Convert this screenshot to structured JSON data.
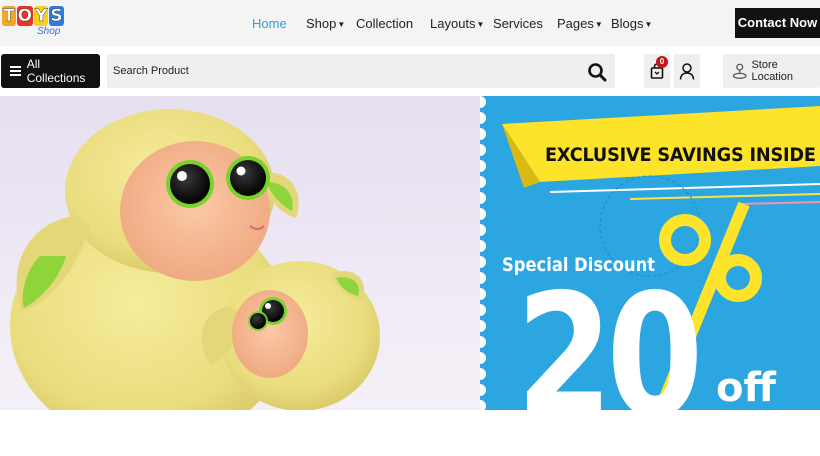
{
  "brand": {
    "logo_letters": [
      "T",
      "O",
      "Y",
      "S"
    ],
    "logo_colors": [
      "#f5a623",
      "#e8332b",
      "#f7d21c",
      "#2f7be0"
    ],
    "logo_sub": "Shop"
  },
  "nav": {
    "items": [
      {
        "label": "Home",
        "active": true,
        "dropdown": false
      },
      {
        "label": "Shop",
        "active": false,
        "dropdown": true
      },
      {
        "label": "Collection",
        "active": false,
        "dropdown": false
      },
      {
        "label": "Layouts",
        "active": false,
        "dropdown": true
      },
      {
        "label": "Services",
        "active": false,
        "dropdown": false
      },
      {
        "label": "Pages",
        "active": false,
        "dropdown": true
      },
      {
        "label": "Blogs",
        "active": false,
        "dropdown": true
      }
    ],
    "contact_label": "Contact Now"
  },
  "toolbar": {
    "collections_label": "All Collections",
    "search_placeholder": "Search Product",
    "cart_count": "0",
    "store_label": "Store Location"
  },
  "hero": {
    "banner_text": "EXCLUSIVE SAVINGS INSIDE",
    "special_text": "Special Discount",
    "discount_number": "20",
    "percent_sign": "%",
    "off_text": "off"
  },
  "colors": {
    "accent": "#2aa0d6",
    "hero_blue": "#2ca6e0",
    "banner_yellow": "#fde32a",
    "badge_red": "#c0171d"
  },
  "icons": {
    "menu": "hamburger-icon",
    "search": "search-icon",
    "cart": "shopping-bag-icon",
    "account": "user-icon",
    "store": "map-pin-icon"
  }
}
